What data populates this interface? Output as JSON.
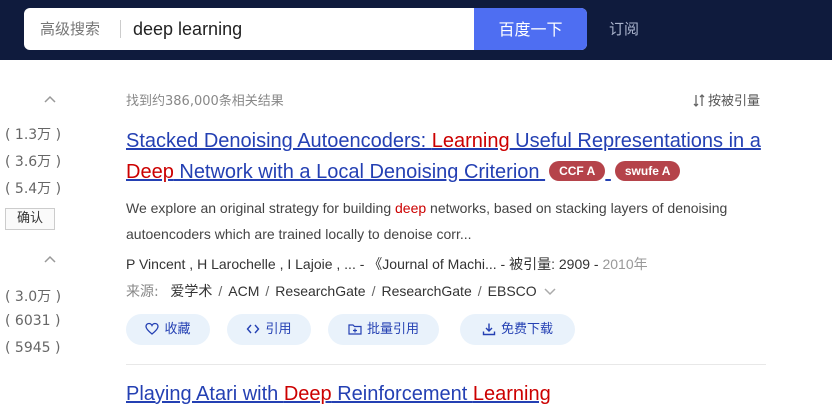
{
  "search": {
    "advanced_label": "高级搜索",
    "query": "deep learning",
    "button_label": "百度一下",
    "subscribe_label": "订阅"
  },
  "sidebar": {
    "group1": [
      "( 1.3万 )",
      "( 3.6万 )",
      "( 5.4万 )"
    ],
    "confirm_label": "确认",
    "group2": [
      "( 3.0万 )",
      "( 6031 )",
      "( 5945 )"
    ]
  },
  "results_meta": {
    "count_text": "找到约386,000条相关结果",
    "sort_label": "按被引量"
  },
  "result1": {
    "title_parts": {
      "p1": "Stacked Denoising Autoencoders: ",
      "p2": "Learning",
      "p3": " Useful Representations in a ",
      "p4": "Deep",
      "p5": " Network with a Local Denoising Criterion"
    },
    "badges": [
      "CCF A",
      "swufe A"
    ],
    "abstract": {
      "a1": "We explore an original strategy for building ",
      "a2": "deep",
      "a3": " networks, based on stacking layers of denoising autoencoders which are trained locally to denoise corr..."
    },
    "authors_line": "P Vincent ,   H Larochelle ,   I Lajoie ,   ... -  《Journal of Machi... -  被引量:  2909  -  ",
    "year": "2010年",
    "sources_label": "来源:",
    "sources": [
      "爱学术",
      "ACM",
      "ResearchGate",
      "ResearchGate",
      "EBSCO"
    ],
    "actions": [
      "收藏",
      "引用",
      "批量引用",
      "免费下载"
    ]
  },
  "result2": {
    "title_parts": {
      "p1": "Playing Atari with ",
      "p2": "Deep",
      "p3": " Reinforcement ",
      "p4": "Learning"
    }
  },
  "colors": {
    "topbar": "#0f1b3d",
    "search_button": "#4e6ef2",
    "link": "#2440b3",
    "highlight": "#cc0000",
    "badge": "#b5434a"
  }
}
